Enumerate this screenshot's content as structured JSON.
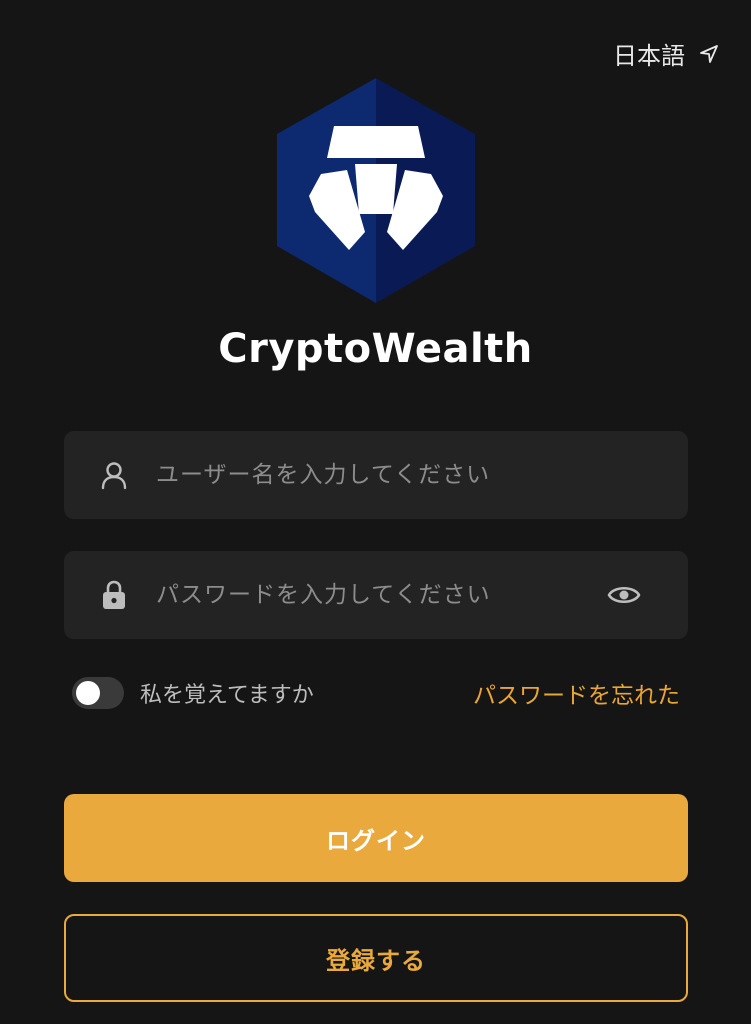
{
  "language": {
    "label": "日本語",
    "icon": "send-arrow-icon"
  },
  "brand": {
    "name": "CryptoWealth",
    "logo": "lion-hexagon-logo",
    "logo_colors": [
      "#0d2a70",
      "#0a1a55"
    ]
  },
  "login_form": {
    "username": {
      "placeholder": "ユーザー名を入力してください",
      "value": "",
      "icon": "user-icon"
    },
    "password": {
      "placeholder": "パスワードを入力してください",
      "value": "",
      "icon": "lock-icon",
      "toggle_icon": "eye-icon"
    },
    "remember_me": {
      "label": "私を覚えてますか",
      "checked": false
    },
    "forgot_password": "パスワードを忘れた",
    "login_button": "ログイン",
    "register_button": "登録する"
  },
  "colors": {
    "background": "#151515",
    "field_background": "#232323",
    "accent": "#eaa93c"
  }
}
